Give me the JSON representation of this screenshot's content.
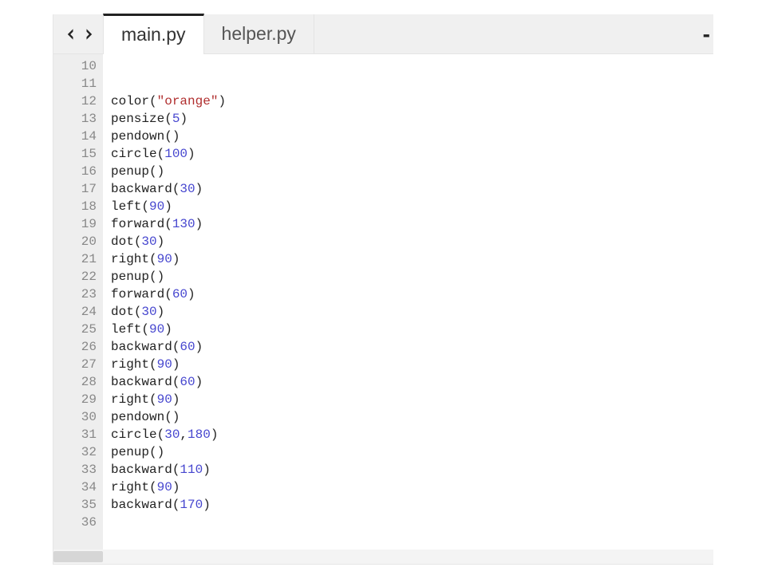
{
  "tabs": [
    {
      "label": "main.py",
      "active": true
    },
    {
      "label": "helper.py",
      "active": false
    }
  ],
  "overflow_glyph": "-",
  "editor": {
    "first_line_number": 10,
    "syntax_colors": {
      "function": "#222222",
      "string": "#b02e2e",
      "number": "#4646cf"
    },
    "lines": [
      {
        "n": 10,
        "tokens": []
      },
      {
        "n": 11,
        "tokens": []
      },
      {
        "n": 12,
        "tokens": [
          {
            "t": "func",
            "v": "color"
          },
          {
            "t": "p",
            "v": "("
          },
          {
            "t": "str",
            "v": "\"orange\""
          },
          {
            "t": "p",
            "v": ")"
          }
        ]
      },
      {
        "n": 13,
        "tokens": [
          {
            "t": "func",
            "v": "pensize"
          },
          {
            "t": "p",
            "v": "("
          },
          {
            "t": "num",
            "v": "5"
          },
          {
            "t": "p",
            "v": ")"
          }
        ]
      },
      {
        "n": 14,
        "tokens": [
          {
            "t": "func",
            "v": "pendown"
          },
          {
            "t": "p",
            "v": "("
          },
          {
            "t": "p",
            "v": ")"
          }
        ]
      },
      {
        "n": 15,
        "tokens": [
          {
            "t": "func",
            "v": "circle"
          },
          {
            "t": "p",
            "v": "("
          },
          {
            "t": "num",
            "v": "100"
          },
          {
            "t": "p",
            "v": ")"
          }
        ]
      },
      {
        "n": 16,
        "tokens": [
          {
            "t": "func",
            "v": "penup"
          },
          {
            "t": "p",
            "v": "("
          },
          {
            "t": "p",
            "v": ")"
          }
        ]
      },
      {
        "n": 17,
        "tokens": [
          {
            "t": "func",
            "v": "backward"
          },
          {
            "t": "p",
            "v": "("
          },
          {
            "t": "num",
            "v": "30"
          },
          {
            "t": "p",
            "v": ")"
          }
        ]
      },
      {
        "n": 18,
        "tokens": [
          {
            "t": "func",
            "v": "left"
          },
          {
            "t": "p",
            "v": "("
          },
          {
            "t": "num",
            "v": "90"
          },
          {
            "t": "p",
            "v": ")"
          }
        ]
      },
      {
        "n": 19,
        "tokens": [
          {
            "t": "func",
            "v": "forward"
          },
          {
            "t": "p",
            "v": "("
          },
          {
            "t": "num",
            "v": "130"
          },
          {
            "t": "p",
            "v": ")"
          }
        ]
      },
      {
        "n": 20,
        "tokens": [
          {
            "t": "func",
            "v": "dot"
          },
          {
            "t": "p",
            "v": "("
          },
          {
            "t": "num",
            "v": "30"
          },
          {
            "t": "p",
            "v": ")"
          }
        ]
      },
      {
        "n": 21,
        "tokens": [
          {
            "t": "func",
            "v": "right"
          },
          {
            "t": "p",
            "v": "("
          },
          {
            "t": "num",
            "v": "90"
          },
          {
            "t": "p",
            "v": ")"
          }
        ]
      },
      {
        "n": 22,
        "tokens": [
          {
            "t": "func",
            "v": "penup"
          },
          {
            "t": "p",
            "v": "("
          },
          {
            "t": "p",
            "v": ")"
          }
        ]
      },
      {
        "n": 23,
        "tokens": [
          {
            "t": "func",
            "v": "forward"
          },
          {
            "t": "p",
            "v": "("
          },
          {
            "t": "num",
            "v": "60"
          },
          {
            "t": "p",
            "v": ")"
          }
        ]
      },
      {
        "n": 24,
        "tokens": [
          {
            "t": "func",
            "v": "dot"
          },
          {
            "t": "p",
            "v": "("
          },
          {
            "t": "num",
            "v": "30"
          },
          {
            "t": "p",
            "v": ")"
          }
        ]
      },
      {
        "n": 25,
        "tokens": [
          {
            "t": "func",
            "v": "left"
          },
          {
            "t": "p",
            "v": "("
          },
          {
            "t": "num",
            "v": "90"
          },
          {
            "t": "p",
            "v": ")"
          }
        ]
      },
      {
        "n": 26,
        "tokens": [
          {
            "t": "func",
            "v": "backward"
          },
          {
            "t": "p",
            "v": "("
          },
          {
            "t": "num",
            "v": "60"
          },
          {
            "t": "p",
            "v": ")"
          }
        ]
      },
      {
        "n": 27,
        "tokens": [
          {
            "t": "func",
            "v": "right"
          },
          {
            "t": "p",
            "v": "("
          },
          {
            "t": "num",
            "v": "90"
          },
          {
            "t": "p",
            "v": ")"
          }
        ]
      },
      {
        "n": 28,
        "tokens": [
          {
            "t": "func",
            "v": "backward"
          },
          {
            "t": "p",
            "v": "("
          },
          {
            "t": "num",
            "v": "60"
          },
          {
            "t": "p",
            "v": ")"
          }
        ]
      },
      {
        "n": 29,
        "tokens": [
          {
            "t": "func",
            "v": "right"
          },
          {
            "t": "p",
            "v": "("
          },
          {
            "t": "num",
            "v": "90"
          },
          {
            "t": "p",
            "v": ")"
          }
        ]
      },
      {
        "n": 30,
        "tokens": [
          {
            "t": "func",
            "v": "pendown"
          },
          {
            "t": "p",
            "v": "("
          },
          {
            "t": "p",
            "v": ")"
          }
        ]
      },
      {
        "n": 31,
        "tokens": [
          {
            "t": "func",
            "v": "circle"
          },
          {
            "t": "p",
            "v": "("
          },
          {
            "t": "num",
            "v": "30"
          },
          {
            "t": "p",
            "v": ","
          },
          {
            "t": "num",
            "v": "180"
          },
          {
            "t": "p",
            "v": ")"
          }
        ]
      },
      {
        "n": 32,
        "tokens": [
          {
            "t": "func",
            "v": "penup"
          },
          {
            "t": "p",
            "v": "("
          },
          {
            "t": "p",
            "v": ")"
          }
        ]
      },
      {
        "n": 33,
        "tokens": [
          {
            "t": "func",
            "v": "backward"
          },
          {
            "t": "p",
            "v": "("
          },
          {
            "t": "num",
            "v": "110"
          },
          {
            "t": "p",
            "v": ")"
          }
        ]
      },
      {
        "n": 34,
        "tokens": [
          {
            "t": "func",
            "v": "right"
          },
          {
            "t": "p",
            "v": "("
          },
          {
            "t": "num",
            "v": "90"
          },
          {
            "t": "p",
            "v": ")"
          }
        ]
      },
      {
        "n": 35,
        "tokens": [
          {
            "t": "func",
            "v": "backward"
          },
          {
            "t": "p",
            "v": "("
          },
          {
            "t": "num",
            "v": "170"
          },
          {
            "t": "p",
            "v": ")"
          }
        ]
      },
      {
        "n": 36,
        "tokens": []
      }
    ]
  }
}
